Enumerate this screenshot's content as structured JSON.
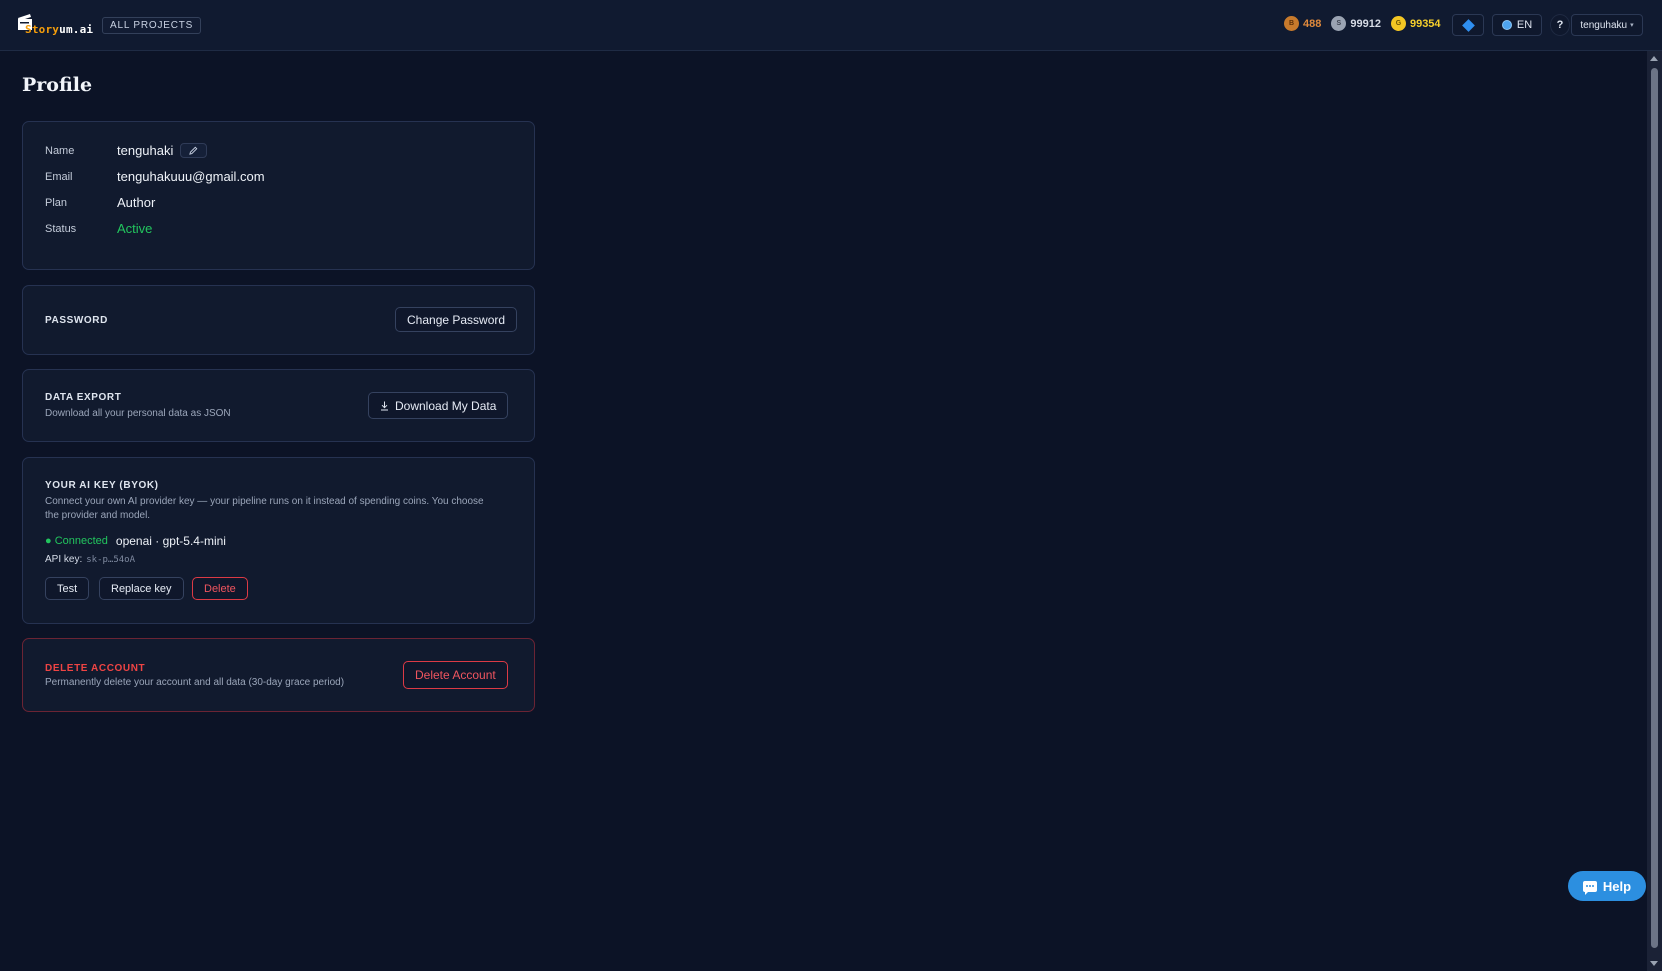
{
  "header": {
    "logo_prefix": "Story",
    "logo_suffix": "um.ai",
    "all_projects": "ALL PROJECTS",
    "currencies": [
      {
        "name": "bronze",
        "symbol": "B",
        "value": "488"
      },
      {
        "name": "silver",
        "symbol": "S",
        "value": "99912"
      },
      {
        "name": "gold",
        "symbol": "G",
        "value": "99354"
      }
    ],
    "language": "EN",
    "help_symbol": "?",
    "user": "tenguhaku"
  },
  "page": {
    "title": "Profile"
  },
  "profile": {
    "name_label": "Name",
    "name_value": "tenguhaki",
    "email_label": "Email",
    "email_value": "tenguhakuuu@gmail.com",
    "plan_label": "Plan",
    "plan_value": "Author",
    "status_label": "Status",
    "status_value": "Active"
  },
  "password": {
    "title": "PASSWORD",
    "button": "Change Password"
  },
  "export": {
    "title": "DATA EXPORT",
    "description": "Download all your personal data as JSON",
    "button": "Download My Data"
  },
  "byok": {
    "title": "YOUR AI KEY (BYOK)",
    "description_line1": "Connect your own AI provider key — your pipeline runs on it instead of spending coins. You choose",
    "description_line2": "the provider and model.",
    "status": "● Connected",
    "provider": "openai · gpt-5.4-mini",
    "api_key_label": "API key:",
    "api_key_value": "sk-p…54oA",
    "test_button": "Test",
    "replace_button": "Replace key",
    "delete_button": "Delete"
  },
  "delete_account": {
    "title": "DELETE ACCOUNT",
    "description": "Permanently delete your account and all data (30-day grace period)",
    "button": "Delete Account"
  },
  "help_fab": {
    "label": "Help"
  },
  "colors": {
    "background": "#0c1326",
    "card": "#111a2e",
    "accent_green": "#22c55e",
    "danger_red": "#ef4444",
    "help_blue": "#2c8fe0"
  }
}
